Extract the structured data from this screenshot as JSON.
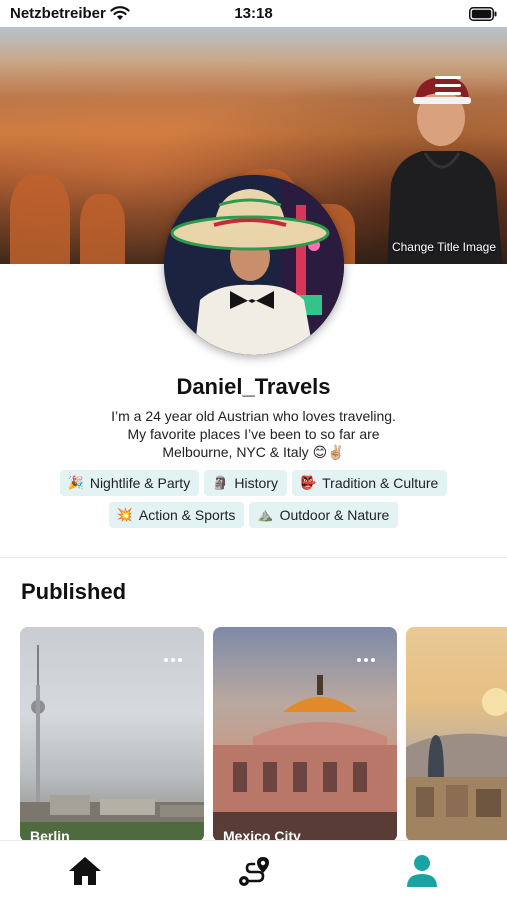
{
  "status_bar": {
    "carrier": "Netzbetreiber",
    "time": "13:18"
  },
  "header": {
    "change_title_label": "Change Title Image"
  },
  "profile": {
    "username": "Daniel_Travels",
    "bio": "I’m a 24 year old Austrian who loves traveling. My favorite places I’ve been to so far are Melbourne, NYC & Italy 😊✌🏼"
  },
  "interests": [
    {
      "emoji": "🎉",
      "label": "Nightlife & Party"
    },
    {
      "emoji": "🗿",
      "label": "History"
    },
    {
      "emoji": "👺",
      "label": "Tradition & Culture"
    },
    {
      "emoji": "💥",
      "label": "Action & Sports"
    },
    {
      "emoji": "⛰️",
      "label": "Outdoor & Nature"
    }
  ],
  "published": {
    "title": "Published",
    "cards": [
      {
        "title": "Berlin"
      },
      {
        "title": "Mexico City"
      },
      {
        "title": ""
      }
    ]
  },
  "tabbar": {
    "icons": [
      "home-icon",
      "route-icon",
      "profile-icon"
    ],
    "active": "profile-icon",
    "accent": "#1aa3a3"
  },
  "colors": {
    "chip_bg": "#e3f2f2",
    "accent": "#1aa3a3"
  }
}
